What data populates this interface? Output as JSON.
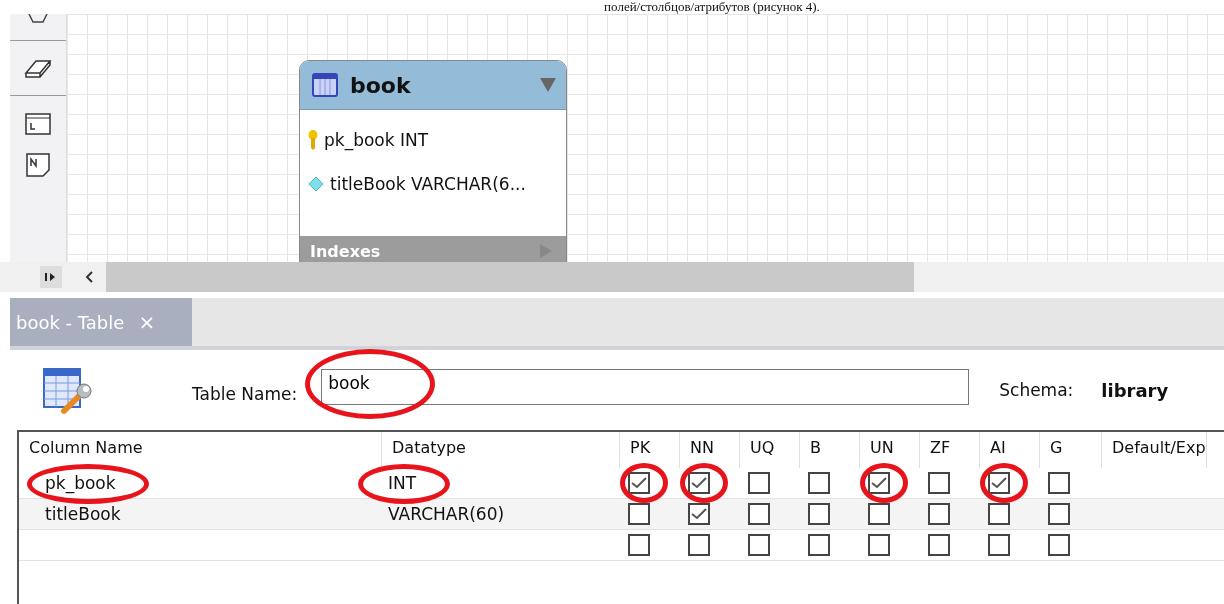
{
  "document_caption": "полей/столбцов/атрибутов (рисунок 4).",
  "diagram": {
    "table": {
      "title": "book",
      "columns": [
        {
          "kind": "primary_key",
          "text": "pk_book INT"
        },
        {
          "kind": "column",
          "text": "titleBook VARCHAR(6..."
        }
      ],
      "section": "Indexes"
    }
  },
  "editor_tab": {
    "label": "book - Table",
    "close": "×",
    "selected": true
  },
  "form": {
    "table_name_label": "Table Name:",
    "table_name": {
      "value": "book",
      "highlighted": true
    },
    "schema_label": "Schema:",
    "schema": "library"
  },
  "grid": {
    "columns": [
      "Column Name",
      "Datatype",
      "PK",
      "NN",
      "UQ",
      "B",
      "UN",
      "ZF",
      "AI",
      "G",
      "Default/Exp"
    ],
    "rows": [
      {
        "kind": "column",
        "name": "pk_book",
        "name_highlighted": true,
        "datatype": "INT",
        "datatype_highlighted": true,
        "flags": [
          {
            "checked": true,
            "highlighted": true
          },
          {
            "checked": true,
            "highlighted": true
          },
          {
            "checked": false,
            "highlighted": false
          },
          {
            "checked": false,
            "highlighted": false
          },
          {
            "checked": true,
            "highlighted": true
          },
          {
            "checked": false,
            "highlighted": false
          },
          {
            "checked": true,
            "highlighted": true
          },
          {
            "checked": false,
            "highlighted": false
          }
        ]
      },
      {
        "kind": "column",
        "name": "titleBook",
        "name_highlighted": false,
        "datatype": "VARCHAR(60)",
        "datatype_highlighted": false,
        "flags": [
          {
            "checked": false,
            "highlighted": false
          },
          {
            "checked": true,
            "highlighted": false
          },
          {
            "checked": false,
            "highlighted": false
          },
          {
            "checked": false,
            "highlighted": false
          },
          {
            "checked": false,
            "highlighted": false
          },
          {
            "checked": false,
            "highlighted": false
          },
          {
            "checked": false,
            "highlighted": false
          },
          {
            "checked": false,
            "highlighted": false
          }
        ]
      },
      {
        "kind": "new",
        "flags": [
          {
            "checked": false,
            "highlighted": false
          },
          {
            "checked": false,
            "highlighted": false
          },
          {
            "checked": false,
            "highlighted": false
          },
          {
            "checked": false,
            "highlighted": false
          },
          {
            "checked": false,
            "highlighted": false
          },
          {
            "checked": false,
            "highlighted": false
          },
          {
            "checked": false,
            "highlighted": false
          },
          {
            "checked": false,
            "highlighted": false
          }
        ]
      }
    ]
  }
}
